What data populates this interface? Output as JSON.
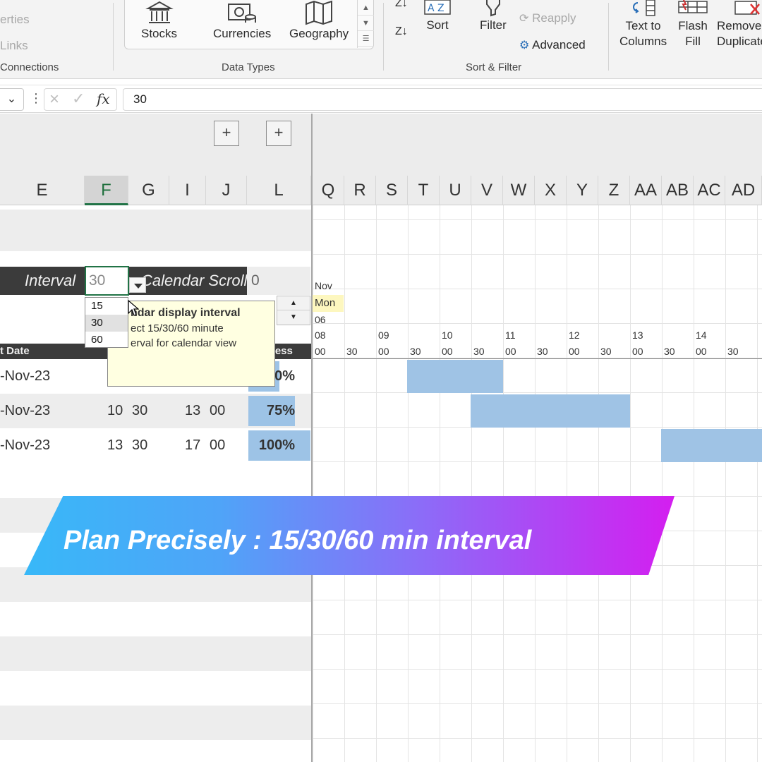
{
  "ribbon": {
    "left_items": [
      "erties",
      "Links",
      "Connections"
    ],
    "data_types": {
      "stocks": "Stocks",
      "currencies": "Currencies",
      "geography": "Geography",
      "group_label": "Data Types"
    },
    "sort_filter": {
      "sort": "Sort",
      "filter": "Filter",
      "reapply": "Reapply",
      "advanced": "Advanced",
      "group_label": "Sort & Filter"
    },
    "tools": {
      "text_to_columns_1": "Text to",
      "text_to_columns_2": "Columns",
      "flash_fill_1": "Flash",
      "flash_fill_2": "Fill",
      "remove_dup_1": "Remove",
      "remove_dup_2": "Duplicate"
    }
  },
  "formula_bar": {
    "value": "30",
    "fx": "fx"
  },
  "columns": [
    "E",
    "F",
    "G",
    "I",
    "J",
    "L",
    "Q",
    "R",
    "S",
    "T",
    "U",
    "V",
    "W",
    "X",
    "Y",
    "Z",
    "AA",
    "AB",
    "AC",
    "AD"
  ],
  "interval": {
    "label": "Interval",
    "value": "30",
    "options": [
      "15",
      "30",
      "60"
    ],
    "scroll_label": "Calendar Scroll",
    "scroll_value": "0"
  },
  "tooltip": {
    "title": "ndar display interval",
    "line1": "ect 15/30/60 minute",
    "line2": "erval for calendar view"
  },
  "task_header": {
    "start": "t Date",
    "progress": "ress"
  },
  "tasks": [
    {
      "date": "-Nov-23",
      "start_h": "",
      "start_m": "",
      "end_h": "",
      "end_m": "",
      "progress": "0%",
      "progress_frac": 0.5
    },
    {
      "date": "-Nov-23",
      "start_h": "10",
      "start_m": "30",
      "end_h": "13",
      "end_m": "00",
      "progress": "75%",
      "progress_frac": 0.75
    },
    {
      "date": "-Nov-23",
      "start_h": "13",
      "start_m": "30",
      "end_h": "17",
      "end_m": "00",
      "progress": "100%",
      "progress_frac": 1.0
    }
  ],
  "calendar": {
    "month": "Nov",
    "weekday": "Mon",
    "day": "06",
    "hours": [
      "08",
      "09",
      "10",
      "11",
      "12",
      "13",
      "14"
    ],
    "slots": [
      "00",
      "30",
      "00",
      "30",
      "00",
      "30",
      "00",
      "30",
      "00",
      "30",
      "00",
      "30",
      "00",
      "30"
    ]
  },
  "banner": {
    "text": "Plan Precisely : 15/30/60 min interval"
  }
}
